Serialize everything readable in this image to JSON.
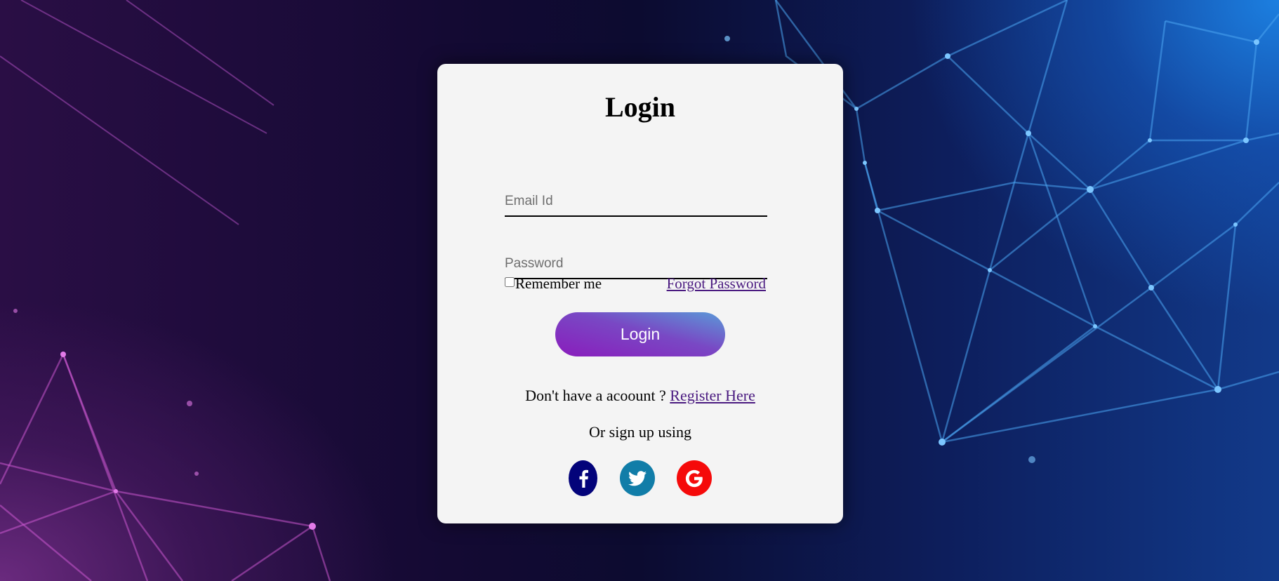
{
  "login": {
    "title": "Login",
    "email_placeholder": "Email Id",
    "password_placeholder": "Password",
    "remember_label": "Remember me",
    "forgot_label": "Forgot Password",
    "submit_label": "Login",
    "register_prompt": "Don't have a acoount ? ",
    "register_link": "Register Here",
    "alt_signup": "Or sign up using",
    "social": [
      {
        "icon": "facebook-icon",
        "color": "#03037a"
      },
      {
        "icon": "twitter-icon",
        "color": "#117da8"
      },
      {
        "icon": "google-icon",
        "color": "#f50a0a"
      }
    ]
  },
  "colors": {
    "card": "#f4f4f4",
    "link": "#4a1a80",
    "button_start": "#8a1cbc",
    "button_end": "#5a9ad8"
  }
}
